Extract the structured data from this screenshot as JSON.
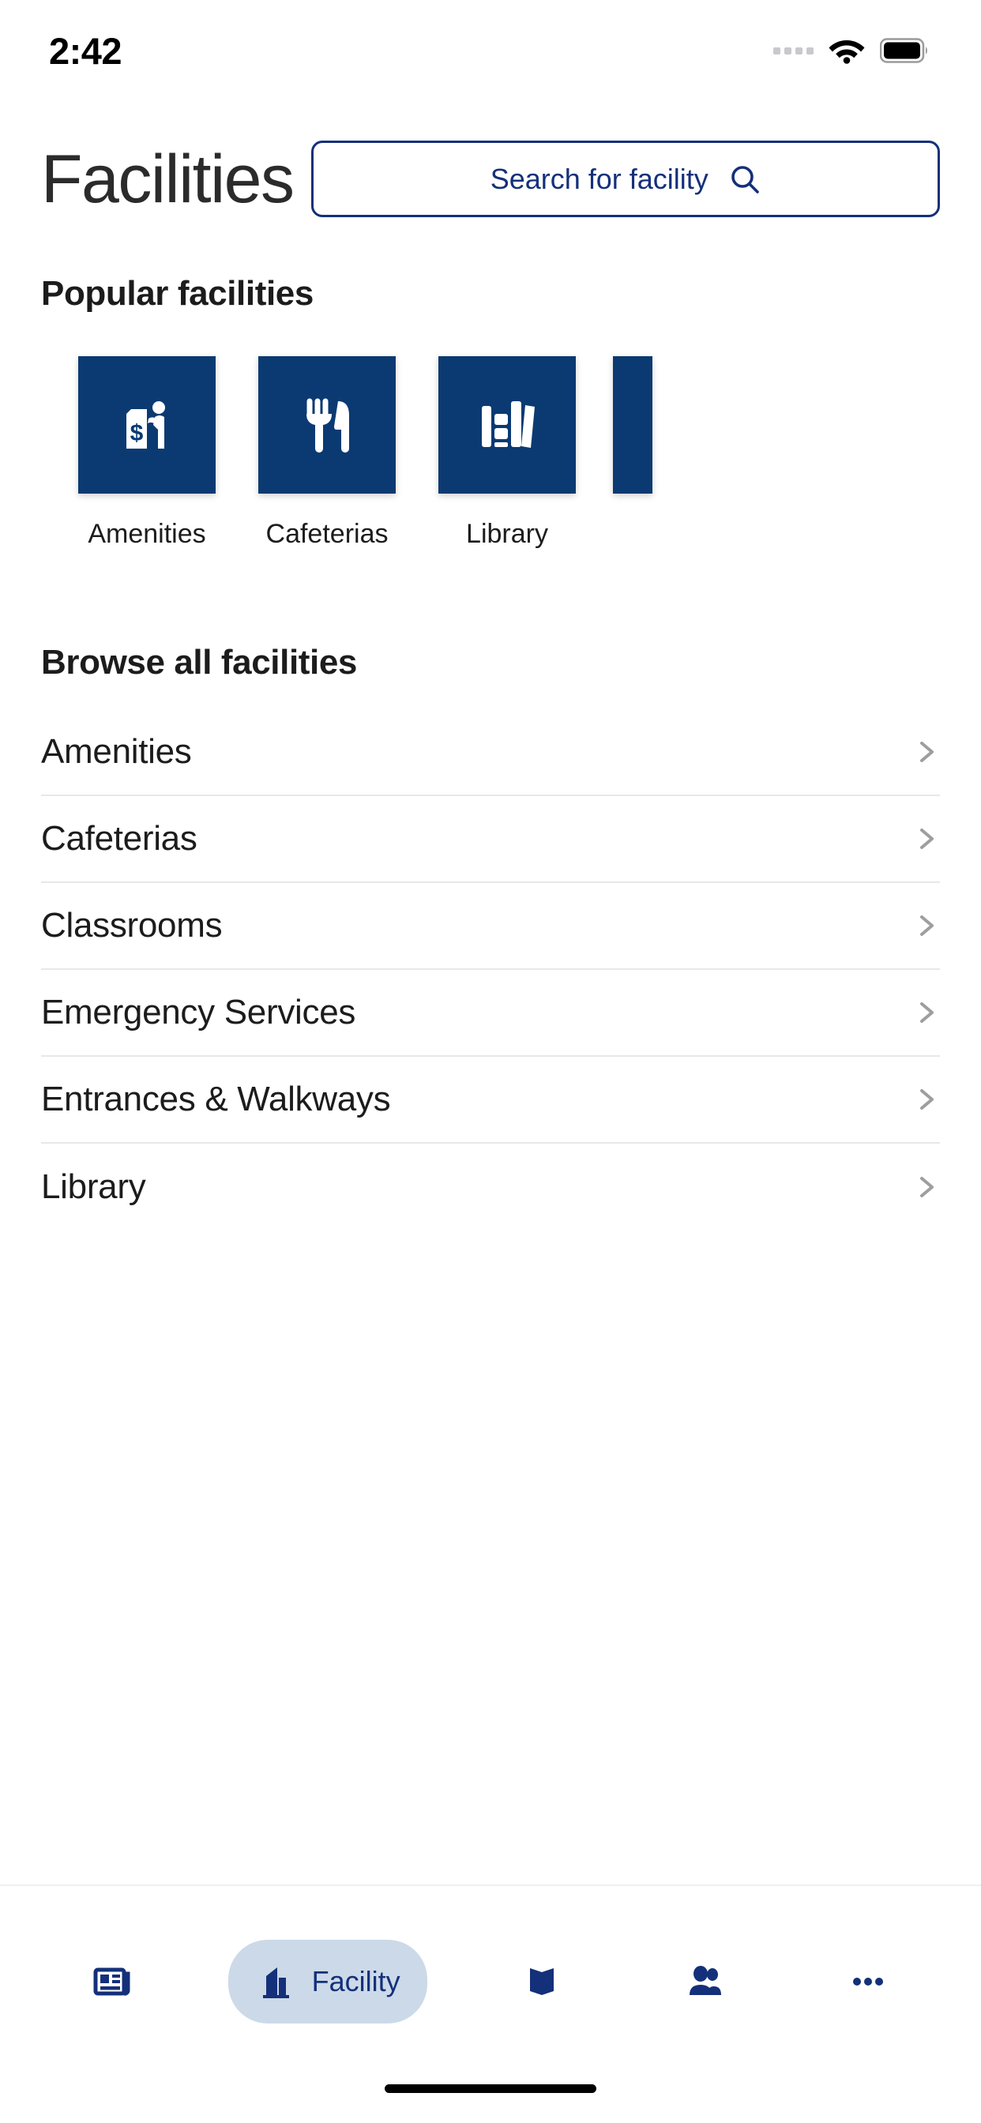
{
  "status_bar": {
    "time": "2:42",
    "signal_icon": "signal-dots-icon",
    "wifi_icon": "wifi-icon",
    "battery_icon": "battery-full-icon"
  },
  "header": {
    "title": "Facilities",
    "search_label": "Search for facility",
    "search_icon": "search-icon"
  },
  "popular": {
    "section_title": "Popular facilities",
    "tiles": [
      {
        "label": "Amenities",
        "icon": "atm-person-icon"
      },
      {
        "label": "Cafeterias",
        "icon": "fork-knife-icon"
      },
      {
        "label": "Library",
        "icon": "books-icon"
      }
    ]
  },
  "browse": {
    "section_title": "Browse all facilities",
    "chevron_icon": "chevron-right-icon",
    "items": [
      {
        "label": "Amenities"
      },
      {
        "label": "Cafeterias"
      },
      {
        "label": "Classrooms"
      },
      {
        "label": "Emergency Services"
      },
      {
        "label": "Entrances & Walkways"
      },
      {
        "label": "Library"
      }
    ]
  },
  "tabbar": {
    "tabs": [
      {
        "label": "",
        "icon": "news-icon",
        "active": false
      },
      {
        "label": "Facility",
        "icon": "building-icon",
        "active": true
      },
      {
        "label": "",
        "icon": "map-icon",
        "active": false
      },
      {
        "label": "",
        "icon": "people-icon",
        "active": false
      },
      {
        "label": "",
        "icon": "more-icon",
        "active": false
      }
    ]
  },
  "colors": {
    "navy": "#0b3a72",
    "navy_text": "#14307a",
    "active_pill": "#ccd9e8",
    "text_primary": "#1c1c1c",
    "divider": "#e8e8e8"
  }
}
